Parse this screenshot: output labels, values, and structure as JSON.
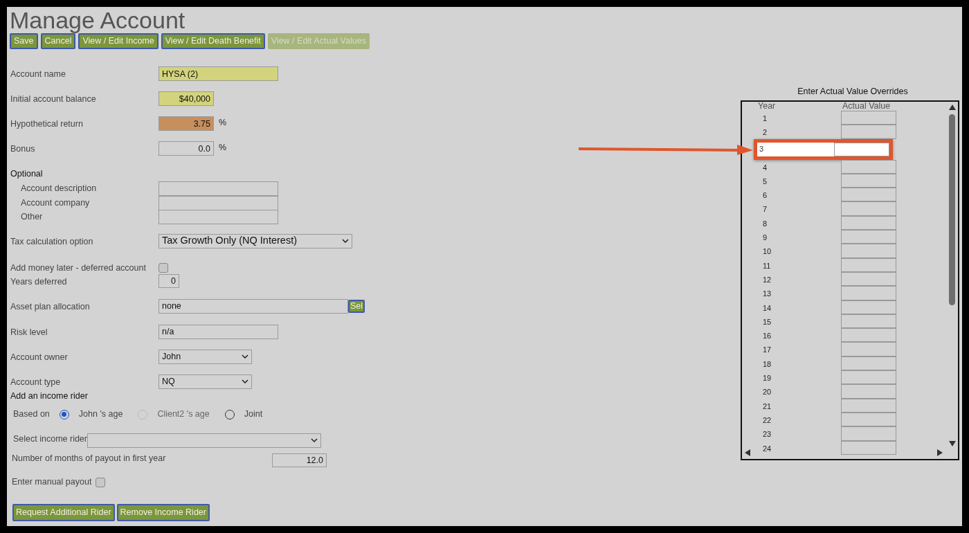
{
  "title": "Manage Account",
  "toolbar": [
    {
      "label": "Save",
      "disabled": false
    },
    {
      "label": "Cancel",
      "disabled": false
    },
    {
      "label": "View / Edit Income",
      "disabled": false
    },
    {
      "label": "View / Edit Death Benefit",
      "disabled": false
    },
    {
      "label": "View / Edit Actual Values",
      "disabled": true
    }
  ],
  "account_name": {
    "label": "Account name",
    "value": "HYSA (2)"
  },
  "initial_balance": {
    "label": "Initial account balance",
    "value": "$40,000"
  },
  "hypothetical_return": {
    "label": "Hypothetical return",
    "value": "3.75",
    "unit": "%"
  },
  "bonus": {
    "label": "Bonus",
    "value": "0.0",
    "unit": "%"
  },
  "optional": {
    "heading": "Optional",
    "fields": [
      {
        "label": "Account description"
      },
      {
        "label": "Account company"
      },
      {
        "label": "Other"
      }
    ]
  },
  "tax_option": {
    "label": "Tax calculation option",
    "value": "Tax Growth Only (NQ Interest)"
  },
  "add_money_later": {
    "label": "Add money later - deferred account",
    "checked": false
  },
  "years_deferred": {
    "label": "Years deferred",
    "value": "0"
  },
  "asset_plan": {
    "label": "Asset plan allocation",
    "value": "none",
    "button": "Sel"
  },
  "risk_level": {
    "label": "Risk level",
    "value": "n/a"
  },
  "account_owner": {
    "label": "Account owner",
    "value": "John"
  },
  "account_type": {
    "label": "Account type",
    "value": "NQ"
  },
  "income_rider": {
    "heading": "Add an income rider",
    "based_on_label": "Based on",
    "options": [
      {
        "label": "John 's age",
        "selected": true,
        "disabled": false
      },
      {
        "label": "Client2 's age",
        "selected": false,
        "disabled": true
      },
      {
        "label": "Joint",
        "selected": false,
        "disabled": false
      }
    ],
    "select_label": "Select income rider",
    "months_label": "Number of months of payout in first year",
    "months_value": "12.0",
    "manual_label": "Enter manual payout",
    "manual_checked": false
  },
  "bottom_buttons": [
    {
      "label": "Request Additional Rider"
    },
    {
      "label": "Remove Income Rider"
    }
  ],
  "overrides": {
    "title": "Enter Actual Value Overrides",
    "columns": [
      "Year",
      "Actual Value"
    ],
    "rows": [
      {
        "year": "1",
        "selected": false
      },
      {
        "year": "2",
        "selected": false
      },
      {
        "year": "3",
        "selected": true
      },
      {
        "year": "4",
        "selected": false
      },
      {
        "year": "5",
        "selected": false
      },
      {
        "year": "6",
        "selected": false
      },
      {
        "year": "7",
        "selected": false
      },
      {
        "year": "8",
        "selected": false
      },
      {
        "year": "9",
        "selected": false
      },
      {
        "year": "10",
        "selected": false
      },
      {
        "year": "11",
        "selected": false
      },
      {
        "year": "12",
        "selected": false
      },
      {
        "year": "13",
        "selected": false
      },
      {
        "year": "14",
        "selected": false
      },
      {
        "year": "15",
        "selected": false
      },
      {
        "year": "16",
        "selected": false
      },
      {
        "year": "17",
        "selected": false
      },
      {
        "year": "18",
        "selected": false
      },
      {
        "year": "19",
        "selected": false
      },
      {
        "year": "20",
        "selected": false
      },
      {
        "year": "21",
        "selected": false
      },
      {
        "year": "22",
        "selected": false
      },
      {
        "year": "23",
        "selected": false
      },
      {
        "year": "24",
        "selected": false
      }
    ]
  }
}
